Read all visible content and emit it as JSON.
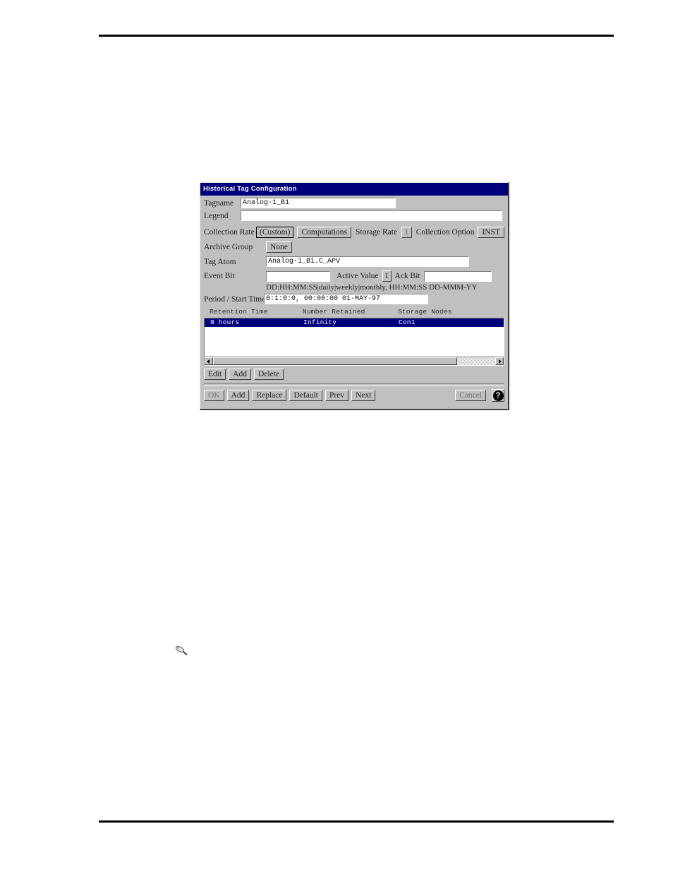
{
  "dialog": {
    "title": "Historical Tag Configuration",
    "fields": {
      "tagname_label": "Tagname",
      "tagname_value": "Analog-1_B1",
      "legend_label": "Legend",
      "legend_value": "",
      "collection_rate_label": "Collection Rate",
      "custom_button": "(Custom)",
      "computations_button": "Computations",
      "storage_rate_label": "Storage Rate",
      "storage_rate_value": "1",
      "collection_option_label": "Collection Option",
      "collection_option_button": "INST",
      "archive_group_label": "Archive Group",
      "archive_group_button": "None",
      "tag_atom_label": "Tag Atom",
      "tag_atom_value": "Analog-1_B1.C_APV",
      "event_bit_label": "Event Bit",
      "event_bit_value": "",
      "active_value_label": "Active Value",
      "active_value_value": "1",
      "ack_bit_label": "Ack Bit",
      "ack_bit_value": "",
      "format_hint": "DD:HH:MM:SS|daily|weekly|monthly,  HH:MM:SS  DD-MMM-YY",
      "period_start_label": "Period / Start Time",
      "period_start_value": "0:1:0:0, 00:00:00   01-MAY-97"
    },
    "list": {
      "columns": [
        "Retention Time",
        "Number Retained",
        "Storage Nodes"
      ],
      "rows": [
        {
          "retention_time": "8 hours",
          "number_retained": "Infinity",
          "storage_nodes": "Con1",
          "selected": true
        }
      ]
    },
    "list_buttons": [
      "Edit",
      "Add",
      "Delete"
    ],
    "action_buttons": [
      "OK",
      "Add",
      "Replace",
      "Default",
      "Prev",
      "Next"
    ],
    "cancel_button": "Cancel",
    "help_button": "?",
    "scrollbar": {
      "left_arrow_icon": "scroll-left-arrow-icon",
      "right_arrow_icon": "scroll-right-arrow-icon"
    },
    "colors": {
      "titlebar_background": "#00007b",
      "dialog_face": "#c0c0c0",
      "selection": "#00007b",
      "field_background": "#ffffff"
    }
  },
  "page": {
    "note_icon": "pencil-note-icon"
  }
}
